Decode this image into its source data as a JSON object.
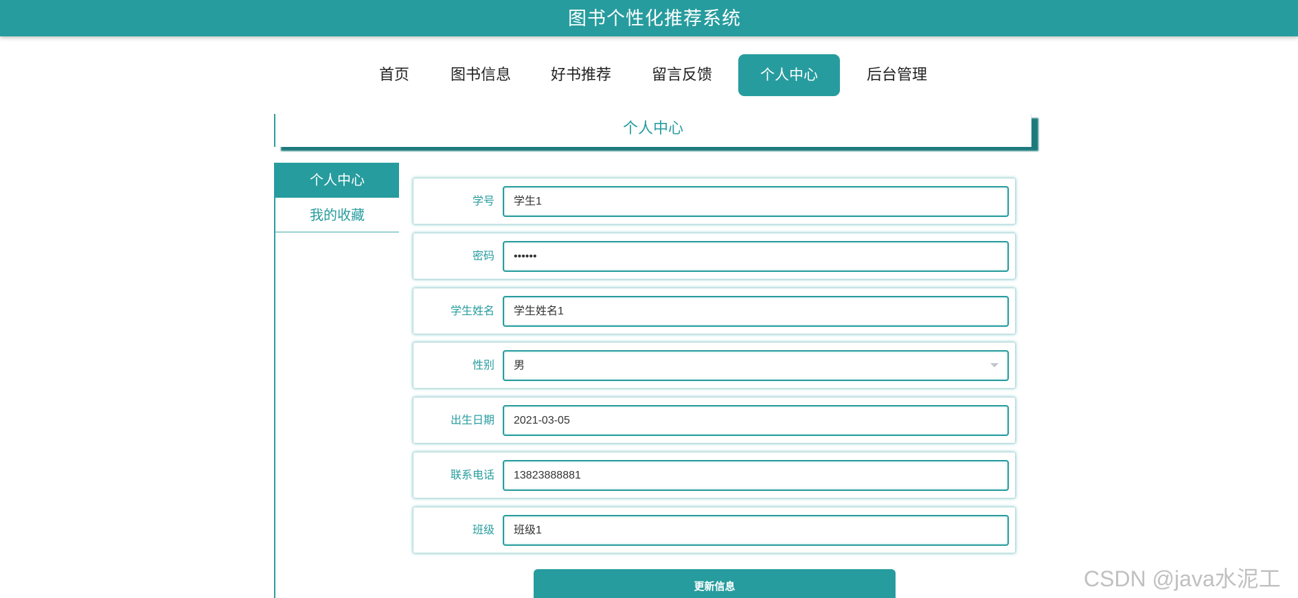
{
  "header": {
    "title": "图书个性化推荐系统"
  },
  "nav": {
    "items": [
      {
        "label": "首页"
      },
      {
        "label": "图书信息"
      },
      {
        "label": "好书推荐"
      },
      {
        "label": "留言反馈"
      },
      {
        "label": "个人中心",
        "active": true
      },
      {
        "label": "后台管理"
      }
    ]
  },
  "page": {
    "title": "个人中心"
  },
  "sidebar": {
    "items": [
      {
        "label": "个人中心",
        "active": true
      },
      {
        "label": "我的收藏"
      }
    ]
  },
  "form": {
    "fields": [
      {
        "label": "学号",
        "value": "学生1"
      },
      {
        "label": "密码",
        "value": "••••••"
      },
      {
        "label": "学生姓名",
        "value": "学生姓名1"
      },
      {
        "label": "性别",
        "value": "男"
      },
      {
        "label": "出生日期",
        "value": "2021-03-05"
      },
      {
        "label": "联系电话",
        "value": "13823888881"
      },
      {
        "label": "班级",
        "value": "班级1"
      }
    ],
    "submit_label": "更新信息"
  },
  "watermark": "CSDN @java水泥工",
  "colors": {
    "accent": "#279c9e",
    "shadow": "#1d7a7c"
  }
}
